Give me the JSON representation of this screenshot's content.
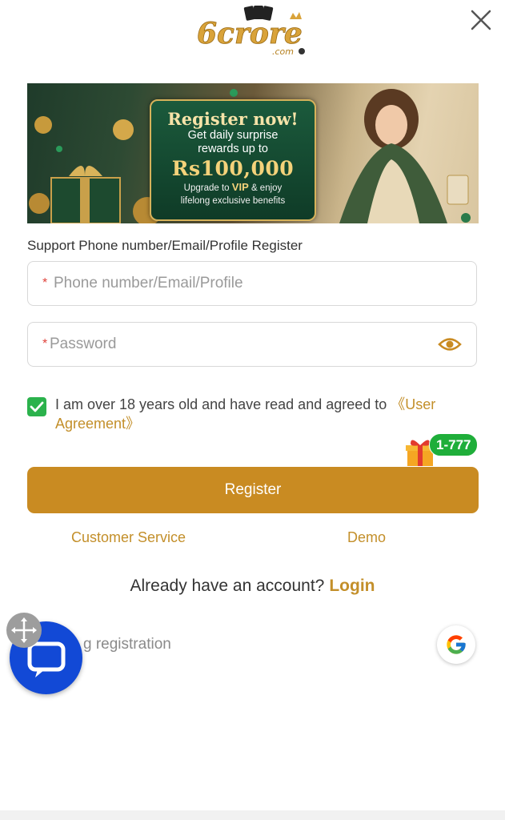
{
  "header": {
    "logo_text": "6crore",
    "logo_sub": ".com",
    "close_icon": "close-icon"
  },
  "banner": {
    "title": "Register now!",
    "line1": "Get daily surprise",
    "line2": "rewards up to",
    "amount": "Rs100,000",
    "small1_pre": "Upgrade to ",
    "small1_vip": "VIP",
    "small1_post": " & enjoy",
    "small2": "lifelong exclusive benefits"
  },
  "form": {
    "support_label": "Support Phone number/Email/Profile Register",
    "account_required_mark": "*",
    "account_placeholder": "Phone number/Email/Profile",
    "account_value": "",
    "password_required_mark": "*",
    "password_placeholder": "Password",
    "password_value": "",
    "eye_icon": "eye-icon",
    "agree_checked": true,
    "agree_text": "I am over 18 years old and have read and agreed to ",
    "agree_link": "《User Agreement》",
    "register_label": "Register"
  },
  "gift": {
    "badge_text": "1-777",
    "icon": "gift-icon"
  },
  "links": {
    "customer_service": "Customer Service",
    "demo": "Demo",
    "have_account": "Already have an account?",
    "login": "Login",
    "other_registration": "g registration"
  },
  "floating": {
    "chat_icon": "chat-icon",
    "move_icon": "move-icon",
    "google_icon": "google-icon"
  },
  "colors": {
    "accent": "#c98b22",
    "link": "#c38f2a",
    "check": "#2bb24c",
    "chat": "#1249d6"
  }
}
